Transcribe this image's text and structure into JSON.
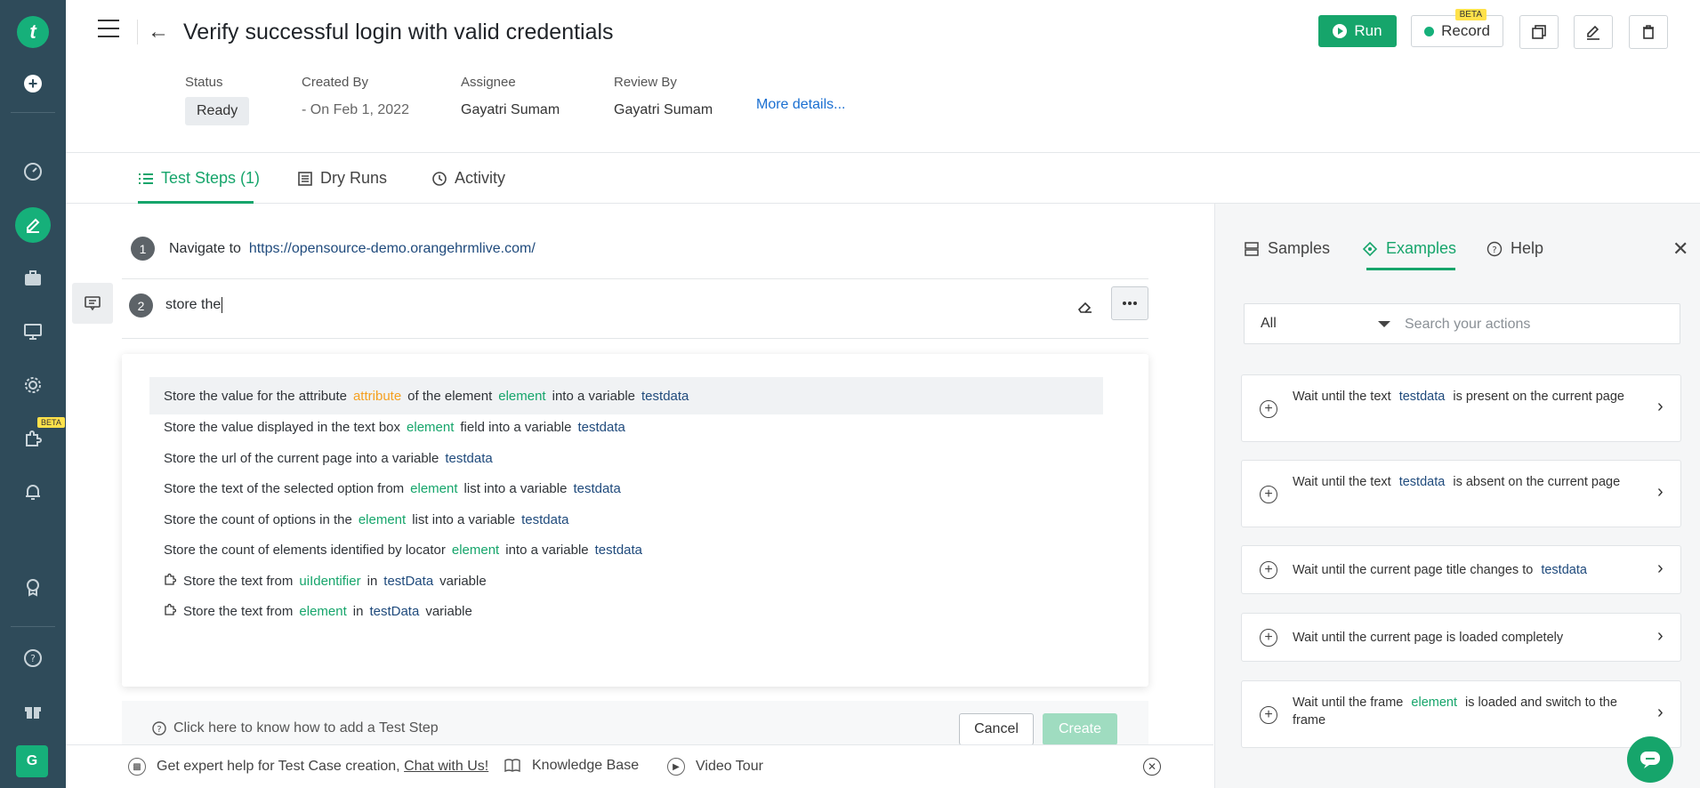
{
  "header": {
    "title": "Verify successful login with valid credentials",
    "run_label": "Run",
    "record_label": "Record",
    "record_badge": "BETA",
    "more_details": "More details..."
  },
  "meta": {
    "status_label": "Status",
    "status_value": "Ready",
    "created_by_label": "Created By",
    "created_by_value": "- On Feb 1, 2022",
    "assignee_label": "Assignee",
    "assignee_value": "Gayatri Sumam",
    "review_by_label": "Review By",
    "review_by_value": "Gayatri Sumam"
  },
  "tabs": [
    {
      "label": "Test Steps (1)",
      "active": true
    },
    {
      "label": "Dry Runs",
      "active": false
    },
    {
      "label": "Activity",
      "active": false
    }
  ],
  "rail": {
    "logo": "t",
    "beta_badge": "BETA",
    "avatar": "G"
  },
  "steps": [
    {
      "num": "1",
      "text": "Navigate to",
      "url": "https://opensource-demo.orangehrmlive.com/"
    },
    {
      "num": "2",
      "input": "store the"
    }
  ],
  "suggestions": [
    {
      "parts": [
        [
          "t",
          "Store the value for the attribute"
        ],
        [
          "o",
          "attribute"
        ],
        [
          "t",
          "of the element"
        ],
        [
          "g",
          "element"
        ],
        [
          "t",
          "into a variable"
        ],
        [
          "b",
          "testdata"
        ]
      ]
    },
    {
      "parts": [
        [
          "t",
          "Store the value displayed in the text box"
        ],
        [
          "g",
          "element"
        ],
        [
          "t",
          "field into a variable"
        ],
        [
          "b",
          "testdata"
        ]
      ]
    },
    {
      "parts": [
        [
          "t",
          "Store the url of the current page into a variable"
        ],
        [
          "b",
          "testdata"
        ]
      ]
    },
    {
      "parts": [
        [
          "t",
          "Store the text of the selected option from"
        ],
        [
          "g",
          "element"
        ],
        [
          "t",
          "list into a variable"
        ],
        [
          "b",
          "testdata"
        ]
      ]
    },
    {
      "parts": [
        [
          "t",
          "Store the count of options in the"
        ],
        [
          "g",
          "element"
        ],
        [
          "t",
          "list into a variable"
        ],
        [
          "b",
          "testdata"
        ]
      ]
    },
    {
      "parts": [
        [
          "t",
          "Store the count of elements identified by locator"
        ],
        [
          "g",
          "element"
        ],
        [
          "t",
          "into a variable"
        ],
        [
          "b",
          "testdata"
        ]
      ]
    },
    {
      "addon": true,
      "parts": [
        [
          "t",
          "Store the text from"
        ],
        [
          "g",
          "uiIdentifier"
        ],
        [
          "t",
          "in"
        ],
        [
          "b",
          "testData"
        ],
        [
          "t",
          "variable"
        ]
      ]
    },
    {
      "addon": true,
      "parts": [
        [
          "t",
          "Store the text from"
        ],
        [
          "g",
          "element"
        ],
        [
          "t",
          "in"
        ],
        [
          "b",
          "testData"
        ],
        [
          "t",
          "variable"
        ]
      ]
    }
  ],
  "editor_footer": {
    "help": "Click here to know how to add a Test Step",
    "cancel": "Cancel",
    "create": "Create"
  },
  "bottom_bar": {
    "expert_text": "Get expert help for Test Case creation,",
    "chat_link": "Chat with Us!",
    "knowledge_base": "Knowledge Base",
    "video_tour": "Video Tour"
  },
  "right_panel": {
    "tabs": [
      {
        "label": "Samples",
        "active": false
      },
      {
        "label": "Examples",
        "active": true
      },
      {
        "label": "Help",
        "active": false
      }
    ],
    "filter_value": "All",
    "search_placeholder": "Search your actions",
    "cards": [
      {
        "parts": [
          [
            "t",
            "Wait until the text"
          ],
          [
            "b",
            "testdata"
          ],
          [
            "t",
            "is present on the current page"
          ]
        ]
      },
      {
        "parts": [
          [
            "t",
            "Wait until the text"
          ],
          [
            "b",
            "testdata"
          ],
          [
            "t",
            "is absent on the current page"
          ]
        ]
      },
      {
        "parts": [
          [
            "t",
            "Wait until the current page title changes to"
          ],
          [
            "b",
            "testdata"
          ]
        ]
      },
      {
        "parts": [
          [
            "t",
            "Wait until the current page is loaded completely"
          ]
        ]
      },
      {
        "parts": [
          [
            "t",
            "Wait until the frame"
          ],
          [
            "g",
            "element"
          ],
          [
            "t",
            "is loaded and switch to the frame"
          ]
        ]
      }
    ]
  },
  "colors": {
    "brand_green": "#16a56b",
    "rail_bg": "#2f4b5a",
    "link_blue": "#1a6fd1",
    "beta_yellow": "#ffe14a"
  }
}
